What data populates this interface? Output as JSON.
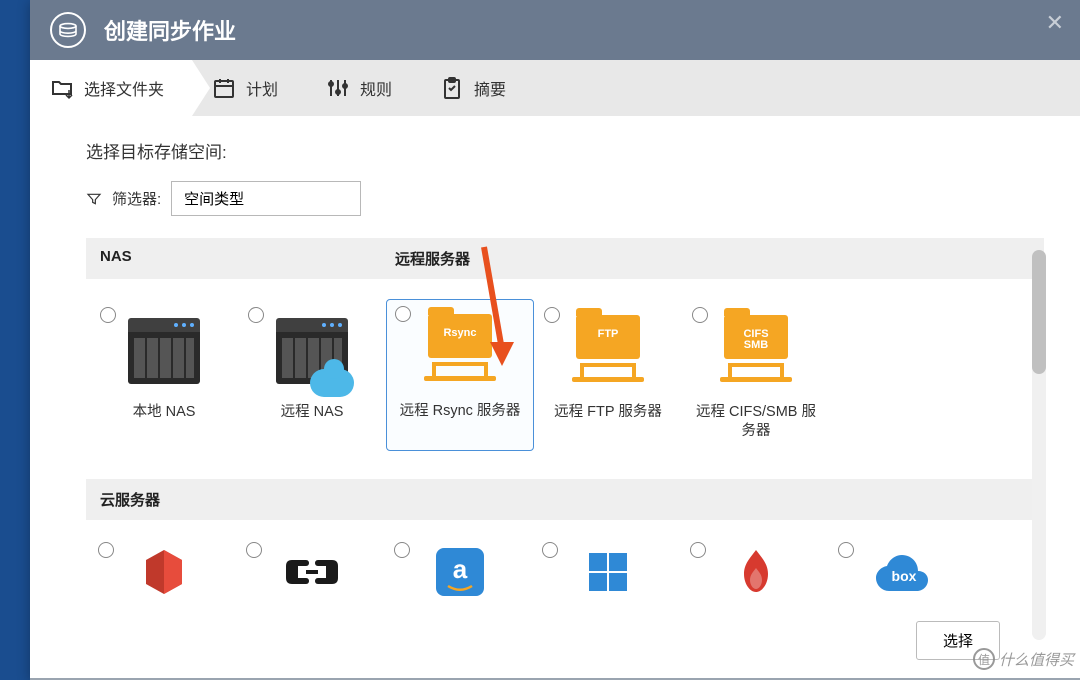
{
  "window": {
    "title": "创建同步作业"
  },
  "tabs": {
    "t0": "选择文件夹",
    "t1": "计划",
    "t2": "规则",
    "t3": "摘要"
  },
  "section": {
    "heading": "选择目标存储空间:",
    "filter_label": "筛选器:",
    "filter_value": "空间类型"
  },
  "groups": {
    "nas": "NAS",
    "remote": "远程服务器",
    "cloud": "云服务器"
  },
  "options": {
    "local_nas": "本地 NAS",
    "remote_nas": "远程 NAS",
    "rsync": "远程 Rsync 服务器",
    "rsync_badge": "Rsync",
    "ftp": "远程 FTP 服务器",
    "ftp_badge": "FTP",
    "cifs": "远程 CIFS/SMB 服务器",
    "cifs_badge": "CIFS\nSMB"
  },
  "cloud_providers": [
    "aws-s3",
    "alibaba",
    "amazon",
    "azure",
    "backblaze",
    "box"
  ],
  "buttons": {
    "select": "选择"
  },
  "watermark": "什么值得买"
}
